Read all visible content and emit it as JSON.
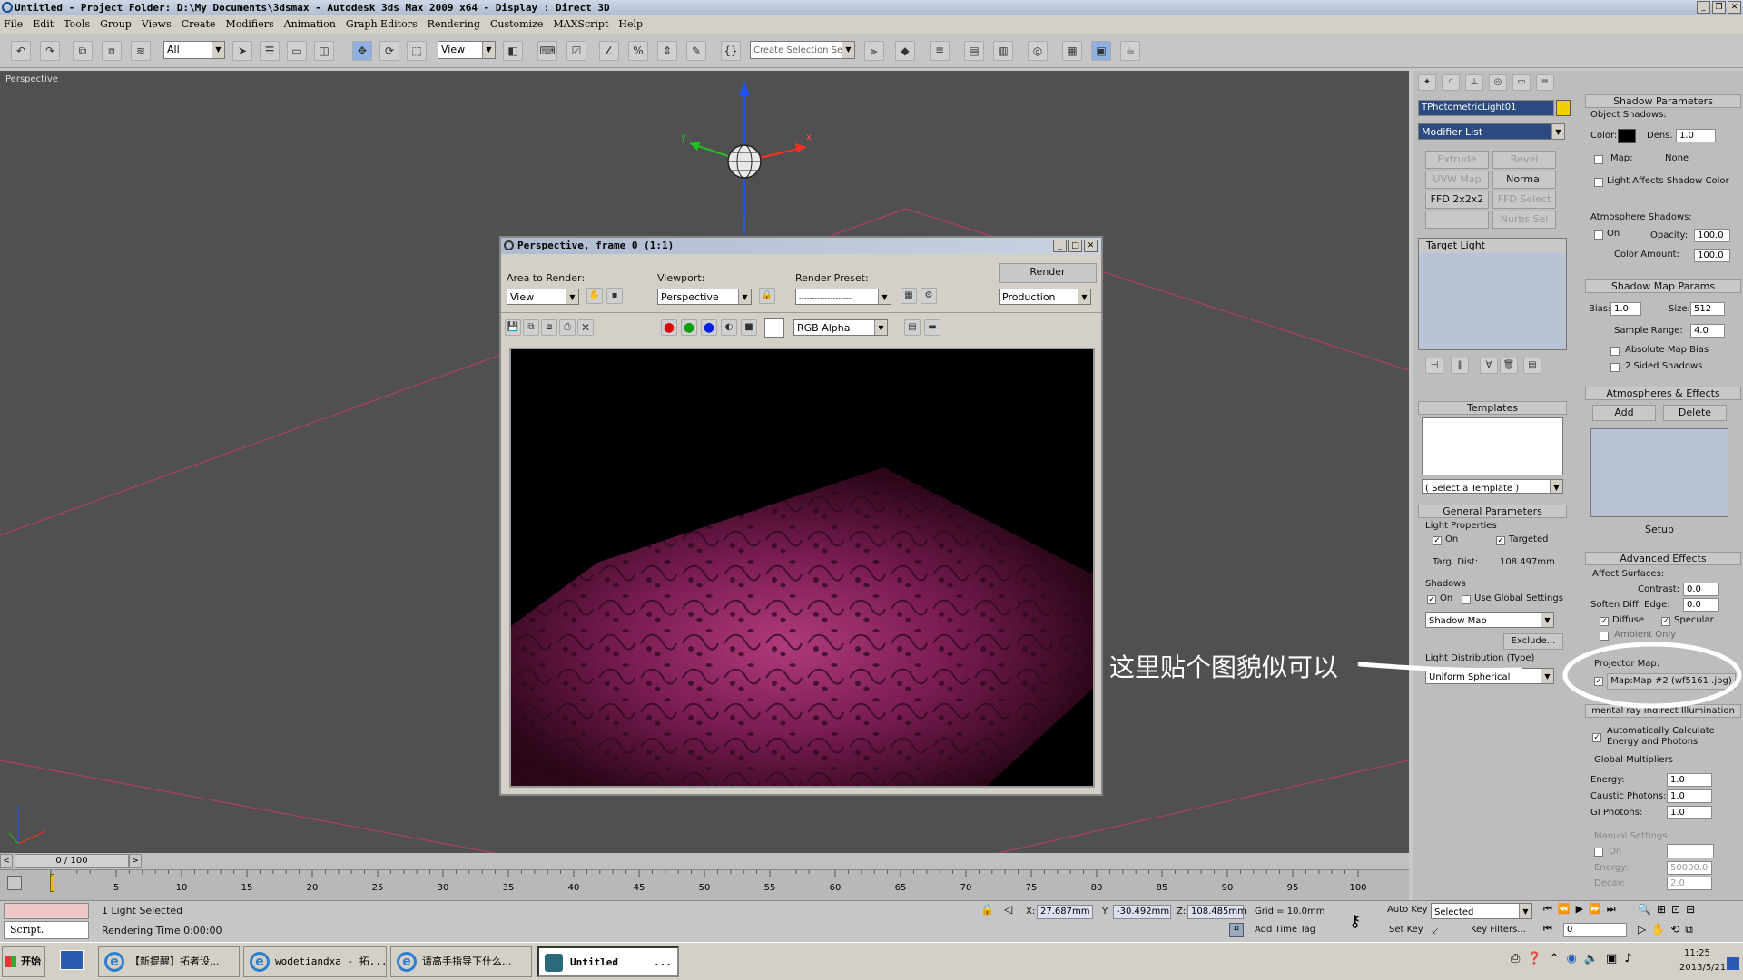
{
  "window": {
    "title": "Untitled    - Project Folder: D:\\My Documents\\3dsmax    - Autodesk 3ds Max  2009 x64    - Display : Direct 3D"
  },
  "menu": [
    "File",
    "Edit",
    "Tools",
    "Group",
    "Views",
    "Create",
    "Modifiers",
    "Animation",
    "Graph Editors",
    "Rendering",
    "Customize",
    "MAXScript",
    "Help"
  ],
  "toolbar": {
    "filter_value": "All",
    "refcoord_value": "View",
    "selection_set_placeholder": "Create Selection Set"
  },
  "viewport": {
    "label": "Perspective",
    "gizmo_x": "x",
    "gizmo_y": "y"
  },
  "render_window": {
    "title": "Perspective, frame 0 (1:1)",
    "area_label": "Area to Render:",
    "area_value": "View",
    "viewport_label": "Viewport:",
    "viewport_value": "Perspective",
    "preset_label": "Render Preset:",
    "preset_value": "--------------------",
    "render_button": "Render",
    "production_value": "Production",
    "channel_value": "RGB Alpha"
  },
  "modify_panel": {
    "object_name": "TPhotometricLight01",
    "object_color": "#f0d000",
    "modifier_list": "Modifier List",
    "buttons": [
      "Extrude",
      "Bevel Profile",
      "UVW Map",
      "Normal",
      "FFD 2x2x2",
      "FFD Select",
      "",
      "Nurbs Sel"
    ],
    "stack_item": "Target Light",
    "templates_title": "Templates",
    "template_select": "( Select a Template )",
    "general_title": "General Parameters",
    "light_props": "Light Properties",
    "on_label": "On",
    "targeted_label": "Targeted",
    "targ_dist_label": "Targ. Dist:",
    "targ_dist_value": "108.497mm",
    "shadows_label": "Shadows",
    "shadows_on": "On",
    "use_global": "Use Global Settings",
    "shadow_type": "Shadow Map",
    "exclude_button": "Exclude...",
    "light_distribution": "Light Distribution (Type)",
    "distribution_value": "Uniform Spherical"
  },
  "shadow_panel": {
    "shadow_params_title": "Shadow Parameters",
    "object_shadows": "Object Shadows:",
    "color_label": "Color:",
    "dens_label": "Dens.",
    "dens_value": "1.0",
    "map_label": "Map:",
    "map_value": "None",
    "light_affects": "Light Affects Shadow Color",
    "atmosphere_shadows": "Atmosphere Shadows:",
    "atm_on": "On",
    "opacity_label": "Opacity:",
    "opacity_value": "100.0",
    "color_amount_label": "Color Amount:",
    "color_amount_value": "100.0",
    "shadow_map_title": "Shadow Map Params",
    "bias_label": "Bias:",
    "bias_value": "1.0",
    "size_label": "Size:",
    "size_value": "512",
    "sample_range_label": "Sample Range:",
    "sample_range_value": "4.0",
    "absolute_map_bias": "Absolute Map Bias",
    "two_sided": "2 Sided Shadows",
    "atmos_effects_title": "Atmospheres & Effects",
    "add_button": "Add",
    "delete_button": "Delete",
    "setup_button": "Setup",
    "advanced_title": "Advanced Effects",
    "affect_surfaces": "Affect Surfaces:",
    "contrast_label": "Contrast:",
    "contrast_value": "0.0",
    "soften_label": "Soften Diff. Edge:",
    "soften_value": "0.0",
    "diffuse_label": "Diffuse",
    "specular_label": "Specular",
    "ambient_label": "Ambient Only",
    "projector_label": "Projector Map:",
    "projector_value": "Map:Map #2 (wf5161 .jpg)",
    "mental_title": "mental ray Indirect Illumination",
    "auto_calc": "Automatically Calculate Energy and Photons",
    "global_mult": "Global Multipliers",
    "energy_label": "Energy:",
    "energy_value": "1.0",
    "caustic_label": "Caustic Photons:",
    "caustic_value": "1.0",
    "gi_label": "GI Photons:",
    "gi_value": "1.0",
    "manual_settings": "Manual Settings",
    "manual_on": "On",
    "manual_energy": "Energy:",
    "manual_energy_value": "50000.0",
    "manual_decay": "Decay:",
    "manual_decay_value": "2.0"
  },
  "annotation": "这里贴个图貌似可以",
  "timeline": {
    "frame_counter": "0 / 100",
    "ticks": [
      "5",
      "10",
      "15",
      "20",
      "25",
      "30",
      "35",
      "40",
      "45",
      "50",
      "55",
      "60",
      "65",
      "70",
      "75",
      "80",
      "85",
      "90",
      "95",
      "100"
    ]
  },
  "status": {
    "script_label": "Script.",
    "selection": "1 Light Selected",
    "render_time": "Rendering Time  0:00:00",
    "x_label": "X:",
    "x_value": "27.687mm",
    "y_label": "Y:",
    "y_value": "-30.492mm",
    "z_label": "Z:",
    "z_value": "108.485mm",
    "grid": "Grid = 10.0mm",
    "add_time_tag": "Add Time Tag",
    "auto_key": "Auto Key",
    "set_key": "Set Key",
    "selected_value": "Selected",
    "key_filters": "Key Filters...",
    "frame_value": "0"
  },
  "taskbar": {
    "start": "开始",
    "tasks": [
      "【新提醒】拓者设...",
      "wodetiandxa - 拓...",
      "请高手指导下什么...",
      "Untitled"
    ],
    "untitled_extra": "...",
    "time": "11:25",
    "date": "2013/5/21"
  }
}
